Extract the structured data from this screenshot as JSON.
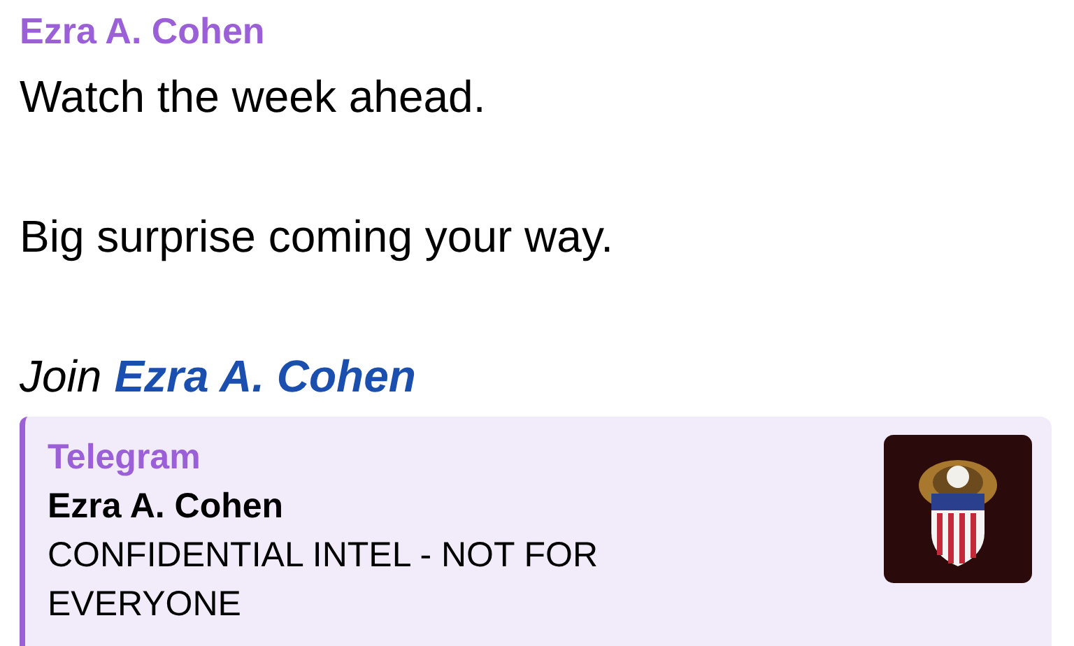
{
  "message": {
    "sender": "Ezra A. Cohen",
    "lines": [
      "Watch the week ahead.",
      "Big surprise coming your way."
    ],
    "join_prefix": "Join",
    "join_link": "Ezra A. Cohen"
  },
  "link_preview": {
    "site": "Telegram",
    "title": "Ezra A. Cohen",
    "description": "CONFIDENTIAL INTEL - NOT FOR EVERYONE"
  }
}
